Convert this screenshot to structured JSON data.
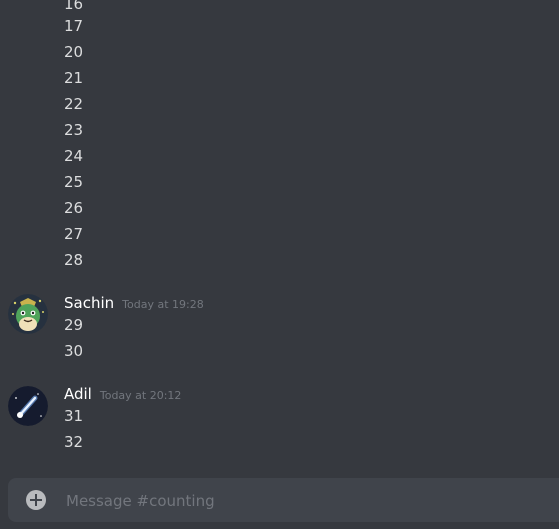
{
  "messages_before": [
    "16",
    "17",
    "20",
    "21",
    "22",
    "23",
    "24",
    "25",
    "26",
    "27",
    "28"
  ],
  "group_sachin": {
    "author": "Sachin",
    "timestamp": "Today at 19:28",
    "lines": [
      "29",
      "30"
    ],
    "avatar_icon": "green-character-avatar"
  },
  "group_adil": {
    "author": "Adil",
    "timestamp": "Today at 20:12",
    "lines": [
      "31",
      "32"
    ],
    "avatar_icon": "comet-avatar"
  },
  "composer": {
    "placeholder": "Message #counting",
    "add_icon": "plus-circle-icon"
  },
  "colors": {
    "background": "#36393f",
    "composer_bg": "#40444b",
    "text": "#dcddde",
    "timestamp": "#72767d",
    "author": "#ffffff"
  }
}
